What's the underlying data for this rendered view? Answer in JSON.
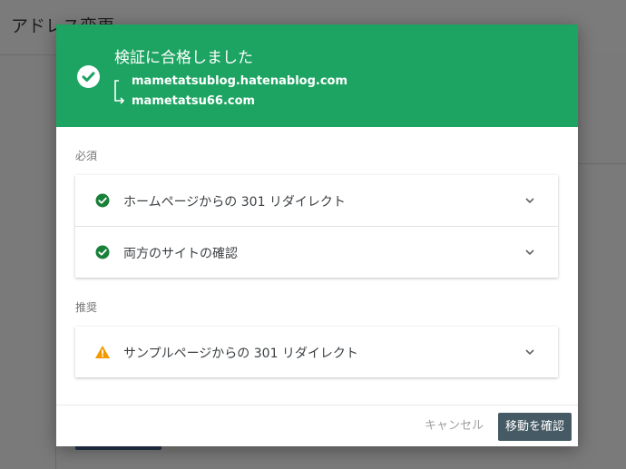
{
  "background": {
    "title": "アドレス変更"
  },
  "dialog": {
    "title": "検証に合格しました",
    "from_domain": "mametatsublog.hatenablog.com",
    "to_domain": "mametatsu66.com",
    "header_color": "#1da462",
    "required_section": {
      "label": "必須",
      "items": [
        {
          "label": "ホームページからの 301 リダイレクト",
          "status": "pass",
          "icon": "check-circle-icon"
        },
        {
          "label": "両方のサイトの確認",
          "status": "pass",
          "icon": "check-circle-icon"
        }
      ]
    },
    "recommended_section": {
      "label": "推奨",
      "items": [
        {
          "label": "サンプルページからの 301 リダイレクト",
          "status": "warning",
          "icon": "warning-icon"
        }
      ]
    },
    "cancel_label": "キャンセル",
    "confirm_label": "移動を確認"
  },
  "colors": {
    "pass": "#188038",
    "warning": "#f29900",
    "confirm_button": "#455a64"
  }
}
